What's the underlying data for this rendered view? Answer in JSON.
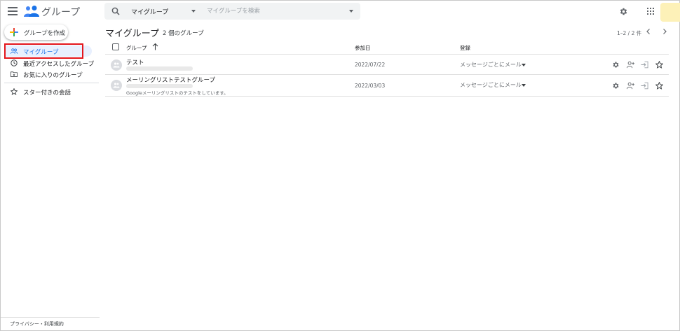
{
  "header": {
    "app_title": "グループ",
    "search": {
      "scope_label": "マイグループ",
      "placeholder": "マイグループを検索"
    }
  },
  "sidebar": {
    "create_label": "グループを作成",
    "items": [
      {
        "label": "マイグループ",
        "icon": "people-icon"
      },
      {
        "label": "最近アクセスしたグループ",
        "icon": "clock-icon"
      },
      {
        "label": "お気に入りのグループ",
        "icon": "folder-star-icon"
      },
      {
        "label": "スター付きの会話",
        "icon": "star-icon"
      }
    ],
    "footer": "プライバシー・利用規約"
  },
  "main": {
    "title": "マイグループ",
    "count": "2 個のグループ",
    "pager": "1–2 / 2 件",
    "columns": {
      "group": "グループ",
      "joined": "参加日",
      "subscription": "登録"
    },
    "rows": [
      {
        "name": "テスト",
        "description": "",
        "joined": "2022/07/22",
        "subscription": "メッセージごとにメール"
      },
      {
        "name": "メーリングリストテストグループ",
        "description": "Googleメーリングリストのテストをしています。",
        "joined": "2022/03/03",
        "subscription": "メッセージごとにメール"
      }
    ]
  },
  "colors": {
    "accent": "#1a73e8",
    "active_bg": "#e8f0fe",
    "annotation": "#e4161c",
    "search_bg": "#f1f3f4"
  }
}
